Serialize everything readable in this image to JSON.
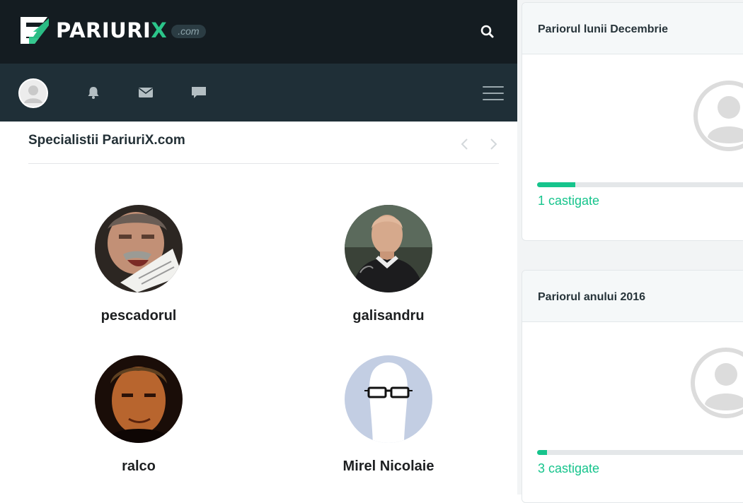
{
  "header": {
    "logo_word": "PARIURI",
    "logo_x": "X",
    "logo_dotcom": ".com",
    "search_icon": "search-icon"
  },
  "nav": {
    "icons": [
      "user-avatar",
      "bell-icon",
      "envelope-icon",
      "chat-icon",
      "hamburger-menu-icon"
    ]
  },
  "specialists": {
    "title": "Specialistii PariuriX.com",
    "items": [
      {
        "name": "pescadorul"
      },
      {
        "name": "galisandru"
      },
      {
        "name": "ralco"
      },
      {
        "name": "Mirel Nicolaie"
      }
    ]
  },
  "month_card": {
    "title": "Pariorul lunii Decembrie",
    "wins": "1 castigate",
    "progress": 0.18
  },
  "year_card": {
    "title": "Pariorul anului 2016",
    "wins": "3 castigate",
    "progress": 0.045
  },
  "colors": {
    "topbar": "#141c21",
    "navbar": "#1f2f37",
    "accent": "#16c48c"
  }
}
